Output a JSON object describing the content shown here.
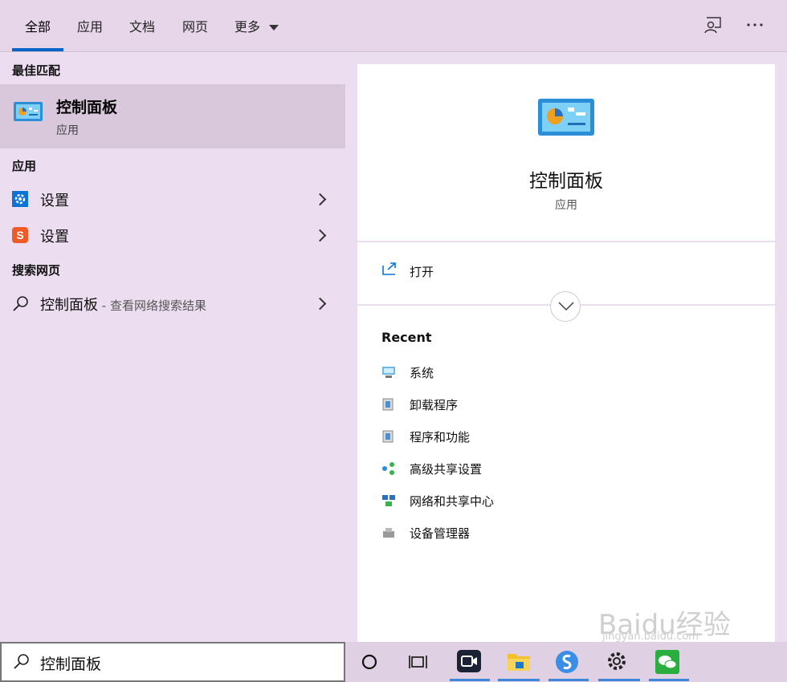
{
  "tabs": [
    {
      "label": "全部"
    },
    {
      "label": "应用"
    },
    {
      "label": "文档"
    },
    {
      "label": "网页"
    },
    {
      "label": "更多"
    }
  ],
  "left": {
    "best_match_heading": "最佳匹配",
    "best_match": {
      "title": "控制面板",
      "subtitle": "应用"
    },
    "apps_heading": "应用",
    "apps": [
      {
        "label": "设置",
        "icon": "gear-icon"
      },
      {
        "label": "设置",
        "icon": "sogou-icon"
      }
    ],
    "web_heading": "搜索网页",
    "web_result": {
      "label": "控制面板",
      "suffix": " - 查看网络搜索结果"
    }
  },
  "right": {
    "title": "控制面板",
    "subtitle": "应用",
    "open_label": "打开",
    "recent_heading": "Recent",
    "recent": [
      {
        "label": "系统"
      },
      {
        "label": "卸载程序"
      },
      {
        "label": "程序和功能"
      },
      {
        "label": "高级共享设置"
      },
      {
        "label": "网络和共享中心"
      },
      {
        "label": "设备管理器"
      }
    ]
  },
  "search": {
    "value": "控制面板"
  },
  "watermark": {
    "text": "Baidu经验",
    "sub": "jingyan.baidu.com"
  },
  "colors": {
    "accent": "#0a64c8",
    "tab_underline": "#0a64c8",
    "taskbar_indicator": "#3b86d8"
  }
}
